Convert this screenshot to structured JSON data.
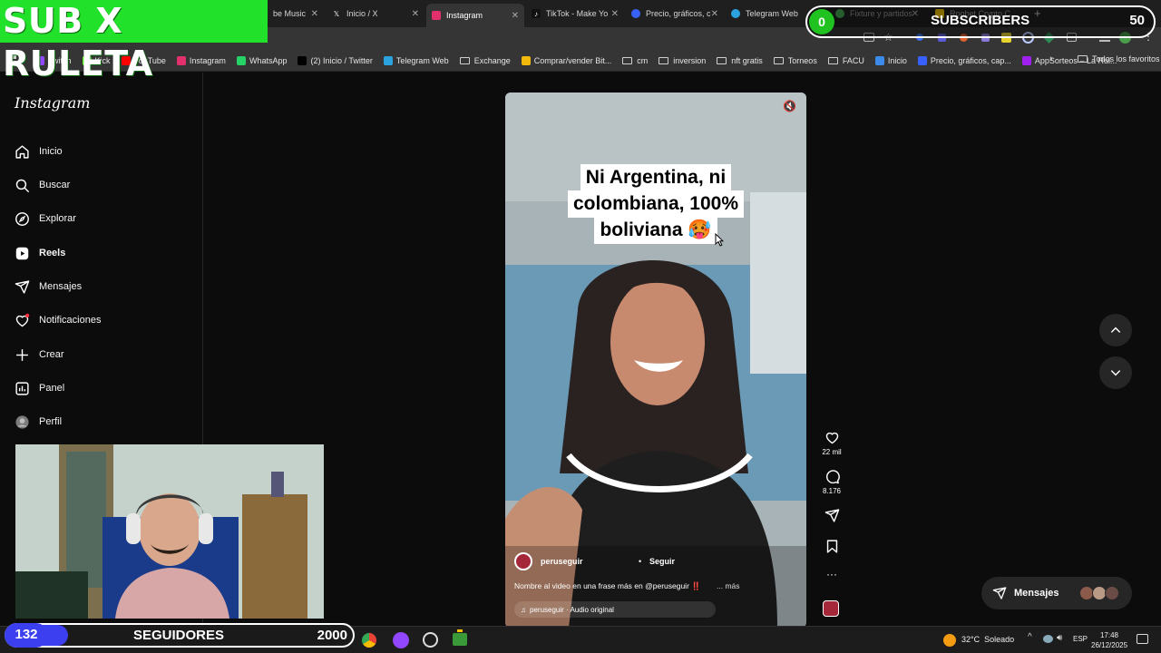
{
  "overlay": {
    "banner": "SUB X RULETA",
    "subscribers": {
      "current": "0",
      "label": "SUBSCRIBERS",
      "goal": "50",
      "progress": 0
    },
    "followers": {
      "current": "132",
      "label": "SEGUIDORES",
      "goal": "2000",
      "progress": 0.066
    }
  },
  "tabs": [
    {
      "label": "be Music",
      "icon": "music-icon",
      "color": "#ff3030"
    },
    {
      "label": "Inicio / X",
      "icon": "x-logo-icon",
      "color": "#000000"
    },
    {
      "label": "Instagram",
      "icon": "instagram-icon",
      "color": "#e1306c",
      "active": true
    },
    {
      "label": "TikTok - Make Yo",
      "icon": "tiktok-icon",
      "color": "#111111"
    },
    {
      "label": "Precio, gráficos, c",
      "icon": "chart-icon",
      "color": "#3861fb"
    },
    {
      "label": "Telegram Web",
      "icon": "telegram-icon",
      "color": "#2aa3df"
    },
    {
      "label": "Fixture y partidos",
      "icon": "ball-icon",
      "color": "#44aa55"
    },
    {
      "label": "Roobet Crypto C",
      "icon": "roobet-icon",
      "color": "#f2c100"
    }
  ],
  "bookmarks": [
    {
      "label": "Twitch",
      "color": "#9146ff"
    },
    {
      "label": "Kick",
      "color": "#53fc18"
    },
    {
      "label": "YouTube",
      "color": "#ff0000"
    },
    {
      "label": "Instagram",
      "color": "#e1306c"
    },
    {
      "label": "WhatsApp",
      "color": "#25d366"
    },
    {
      "label": "(2) Inicio / Twitter",
      "color": "#000000"
    },
    {
      "label": "Telegram Web",
      "color": "#2aa3df"
    },
    {
      "label": "Exchange",
      "folder": true
    },
    {
      "label": "Comprar/vender Bit...",
      "color": "#f0b90b"
    },
    {
      "label": "cm",
      "folder": true
    },
    {
      "label": "inversion",
      "folder": true
    },
    {
      "label": "nft gratis",
      "folder": true
    },
    {
      "label": "Torneos",
      "folder": true
    },
    {
      "label": "FACU",
      "folder": true
    },
    {
      "label": "Inicio",
      "color": "#3b8beb"
    },
    {
      "label": "Precio, gráficos, cap...",
      "color": "#3861fb"
    },
    {
      "label": "AppSorteos – La Rul...",
      "color": "#a020f0"
    }
  ],
  "all_bookmarks": "Todos los favoritos",
  "instagram": {
    "logo": "Instagram",
    "nav": [
      {
        "label": "Inicio",
        "icon": "home-icon"
      },
      {
        "label": "Buscar",
        "icon": "search-icon"
      },
      {
        "label": "Explorar",
        "icon": "compass-icon"
      },
      {
        "label": "Reels",
        "icon": "reels-icon",
        "active": true
      },
      {
        "label": "Mensajes",
        "icon": "send-icon"
      },
      {
        "label": "Notificaciones",
        "icon": "heart-icon"
      },
      {
        "label": "Crear",
        "icon": "plus-icon"
      },
      {
        "label": "Panel",
        "icon": "panel-icon"
      },
      {
        "label": "Perfil",
        "icon": "avatar-icon"
      }
    ],
    "reel": {
      "caption_lines": [
        "Ni Argentina, ni",
        "colombiana, 100%",
        "boliviana 🥵"
      ],
      "username": "peruseguir",
      "follow": "Seguir",
      "description": "Nombre al video en una frase más en @peruseguir ‼️",
      "more": "... más",
      "audio": "peruseguir · Audio original",
      "likes": "22 mil",
      "comments": "8.176"
    },
    "messages_pill": "Mensajes"
  },
  "taskbar": {
    "weather": "32°C  Soleado",
    "lang": "ESP",
    "time": "17:48",
    "date": "26/12/2025"
  }
}
